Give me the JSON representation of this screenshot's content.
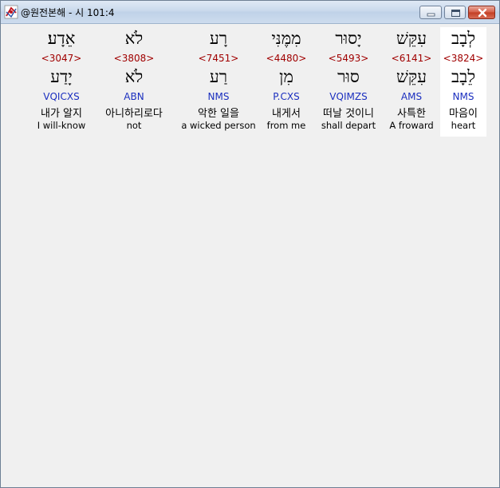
{
  "window": {
    "title": "@원전본해 - 시 101:4",
    "app_icon": "app-logo-icon",
    "controls": [
      "minimize-icon",
      "maximize-icon",
      "close-icon"
    ]
  },
  "words": [
    {
      "hebrew": "לְבָב",
      "strong": "<3824>",
      "lemma": "לֵבָב",
      "parsing": "NMS",
      "korean": "마음이",
      "english": "heart",
      "selected": true
    },
    {
      "hebrew": "עִקֵּשׁ",
      "strong": "<6141>",
      "lemma": "עִקֵּשׁ",
      "parsing": "AMS",
      "korean": "사특한",
      "english": "A froward",
      "selected": false
    },
    {
      "hebrew": "יָסוּר",
      "strong": "<5493>",
      "lemma": "סוּר",
      "parsing": "VQIMZS",
      "korean": "떠날 것이니",
      "english": "shall depart",
      "selected": false
    },
    {
      "hebrew": "מִמֶּנִּי",
      "strong": "<4480>",
      "lemma": "מִן",
      "parsing": "P.CXS",
      "korean": "내게서",
      "english": "from me",
      "selected": false
    },
    {
      "hebrew": "רָע",
      "strong": "<7451>",
      "lemma": "רַע",
      "parsing": "NMS",
      "korean": "악한 일을",
      "english": "a wicked person",
      "selected": false
    },
    {
      "hebrew": "לֹא",
      "strong": "<3808>",
      "lemma": "לֹא",
      "parsing": "ABN",
      "korean": "아니하리로다",
      "english": "not",
      "selected": false
    },
    {
      "hebrew": "אֵדָע׃",
      "strong": "<3047>",
      "lemma": "יָדַע",
      "parsing": "VQICXS",
      "korean": "내가 알지",
      "english": "I will-know",
      "selected": false
    }
  ],
  "colors": {
    "strong": "#a00000",
    "parsing": "#1b2fbf",
    "text": "#000000",
    "selected_bg": "#ffffff",
    "background": "#f0f0f0"
  }
}
